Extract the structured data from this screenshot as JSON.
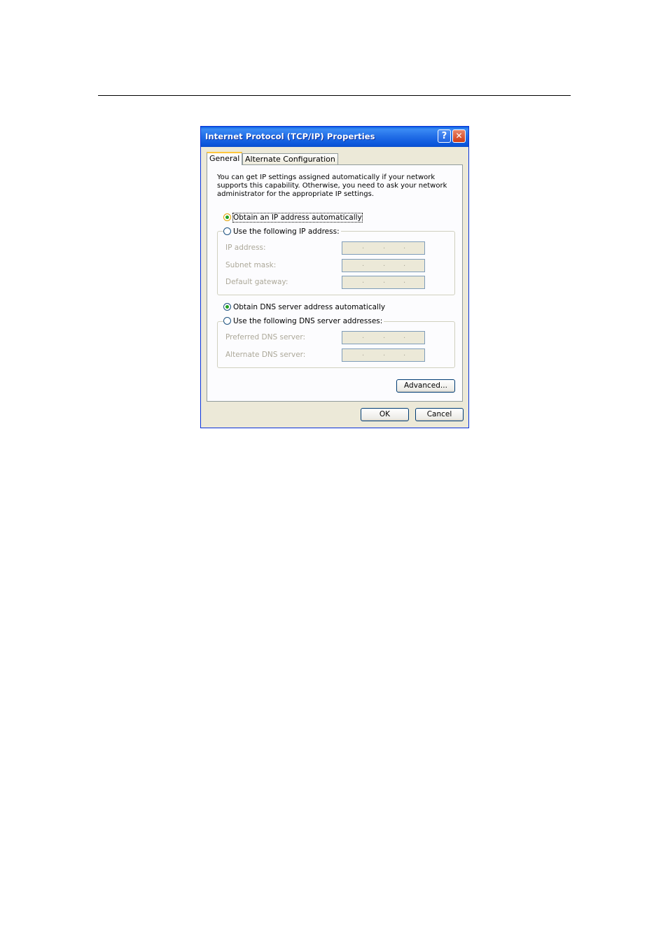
{
  "dialog": {
    "title": "Internet Protocol (TCP/IP) Properties",
    "help_glyph": "?",
    "close_glyph": "✕",
    "tabs": [
      {
        "label": "General",
        "active": true
      },
      {
        "label": "Alternate Configuration",
        "active": false
      }
    ],
    "intro_text": "You can get IP settings assigned automatically if your network supports this capability. Otherwise, you need to ask your network administrator for the appropriate IP settings.",
    "ip": {
      "auto_label": "Obtain an IP address automatically",
      "manual_label": "Use the following IP address:",
      "selected": "auto",
      "fields": [
        {
          "label": "IP address:",
          "value": ". . ."
        },
        {
          "label": "Subnet mask:",
          "value": ". . ."
        },
        {
          "label": "Default gateway:",
          "value": ". . ."
        }
      ]
    },
    "dns": {
      "auto_label": "Obtain DNS server address automatically",
      "manual_label": "Use the following DNS server addresses:",
      "selected": "auto",
      "fields": [
        {
          "label": "Preferred DNS server:",
          "value": ". . ."
        },
        {
          "label": "Alternate DNS server:",
          "value": ". . ."
        }
      ]
    },
    "buttons": {
      "advanced": "Advanced...",
      "ok": "OK",
      "cancel": "Cancel"
    }
  }
}
